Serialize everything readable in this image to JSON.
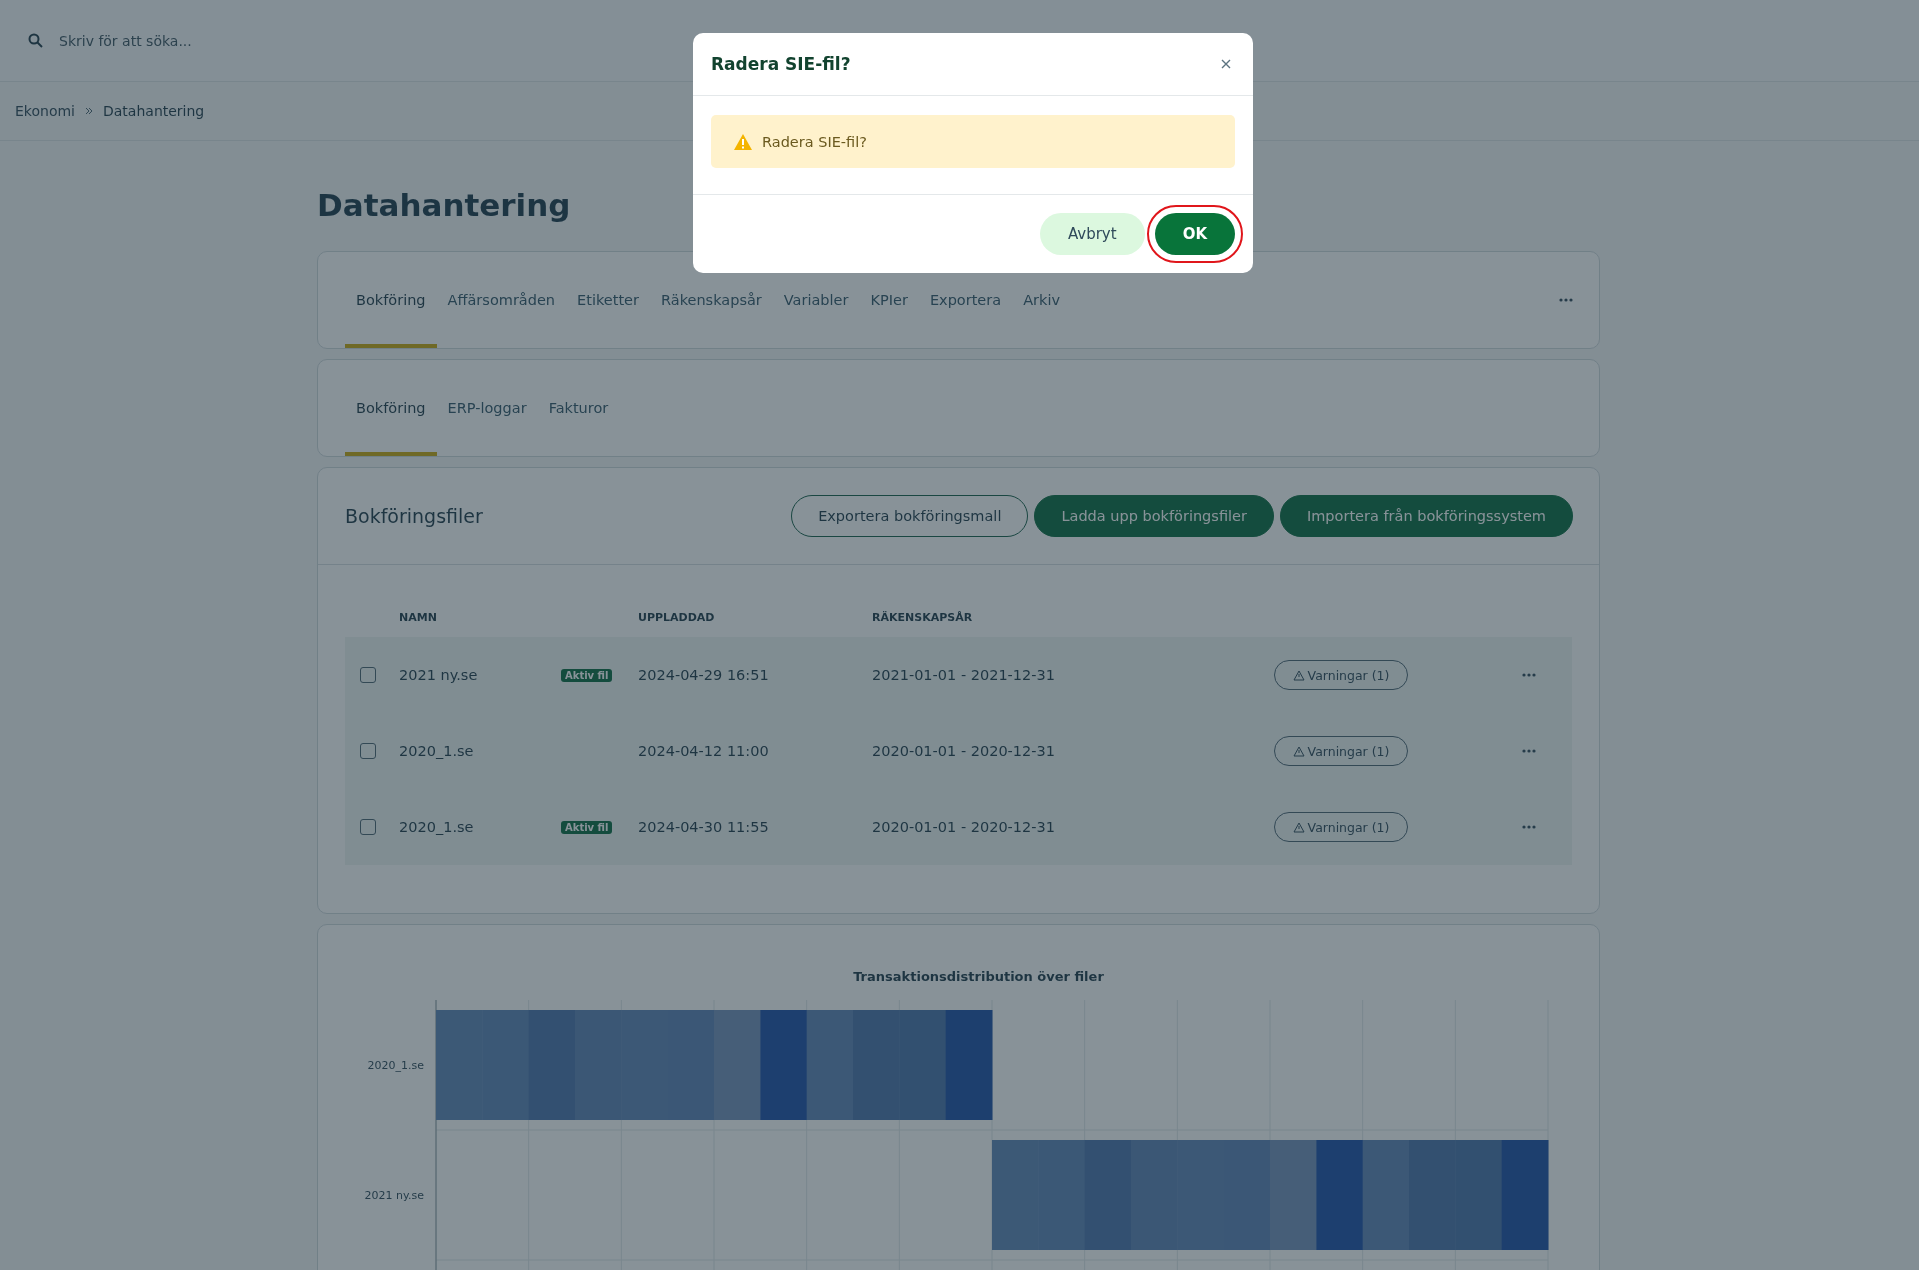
{
  "search": {
    "placeholder": "Skriv för att söka..."
  },
  "breadcrumb": [
    "Ekonomi",
    "Datahantering"
  ],
  "page_title": "Datahantering",
  "tabs": [
    {
      "label": "Bokföring",
      "selected": true
    },
    {
      "label": "Affärsområden",
      "selected": false
    },
    {
      "label": "Etiketter",
      "selected": false
    },
    {
      "label": "Räkenskapsår",
      "selected": false
    },
    {
      "label": "Variabler",
      "selected": false
    },
    {
      "label": "KPIer",
      "selected": false
    },
    {
      "label": "Exportera",
      "selected": false
    },
    {
      "label": "Arkiv",
      "selected": false
    }
  ],
  "subtabs": [
    {
      "label": "Bokföring",
      "selected": true
    },
    {
      "label": "ERP-loggar",
      "selected": false
    },
    {
      "label": "Fakturor",
      "selected": false
    }
  ],
  "files": {
    "title": "Bokföringsfiler",
    "buttons": [
      {
        "label": "Exportera bokföringsmall",
        "kind": "outline"
      },
      {
        "label": "Ladda upp bokföringsfiler",
        "kind": "filled"
      },
      {
        "label": "Importera från bokföringssystem",
        "kind": "filled"
      }
    ],
    "columns": [
      "NAMN",
      "UPPLADDAD",
      "RÄKENSKAPSÅR"
    ],
    "rows": [
      {
        "checked": false,
        "name": "2021 ny.se",
        "badge": "Aktiv fil",
        "uploaded": "2024-04-29 16:51",
        "year": "2021-01-01 - 2021-12-31",
        "warnings": "Varningar (1)"
      },
      {
        "checked": false,
        "name": "2020_1.se",
        "uploaded": "2024-04-12 11:00",
        "year": "2020-01-01 - 2020-12-31",
        "warnings": "Varningar (1)"
      },
      {
        "checked": false,
        "name": "2020_1.se",
        "badge": "Aktiv fil",
        "uploaded": "2024-04-30 11:55",
        "year": "2020-01-01 - 2020-12-31",
        "warnings": "Varningar (1)"
      }
    ]
  },
  "chart": {
    "title": "Transaktionsdistribution över filer",
    "rows": [
      {
        "label": "2020_1.se"
      },
      {
        "label": "2021 ny.se"
      }
    ]
  },
  "dialog": {
    "title": "Radera SIE-fil?",
    "message": "Radera SIE-fil?",
    "buttons": [
      {
        "label": "Avbryt",
        "kind": "secondary",
        "highlighted": false
      },
      {
        "label": "OK",
        "kind": "primary",
        "highlighted": true
      }
    ]
  }
}
